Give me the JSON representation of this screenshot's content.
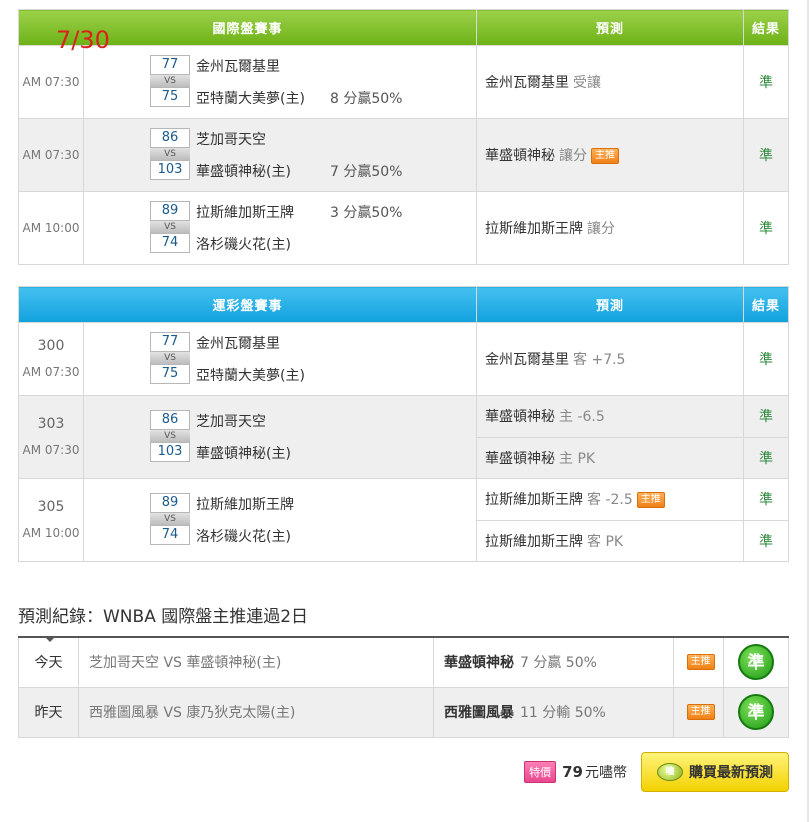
{
  "overlay_date": "7/30",
  "intl": {
    "headers": {
      "event": "國際盤賽事",
      "prediction": "預測",
      "result": "結果"
    },
    "games": [
      {
        "time": "AM 07:30",
        "score1": "77",
        "score2": "75",
        "team1": "金州瓦爾基里",
        "team2": "亞特蘭大美夢(主)",
        "handicap": "8 分贏50%",
        "handicap_row": 2,
        "pred_team": "金州瓦爾基里",
        "pred_note": "受讓",
        "main": false,
        "result": "準"
      },
      {
        "time": "AM 07:30",
        "score1": "86",
        "score2": "103",
        "team1": "芝加哥天空",
        "team2": "華盛頓神秘(主)",
        "handicap": "7 分贏50%",
        "handicap_row": 2,
        "pred_team": "華盛頓神秘",
        "pred_note": "讓分",
        "main": true,
        "result": "準"
      },
      {
        "time": "AM 10:00",
        "score1": "89",
        "score2": "74",
        "team1": "拉斯維加斯王牌",
        "team2": "洛杉磯火花(主)",
        "handicap": "3 分贏50%",
        "handicap_row": 1,
        "pred_team": "拉斯維加斯王牌",
        "pred_note": "讓分",
        "main": false,
        "result": "準"
      }
    ]
  },
  "sports": {
    "headers": {
      "event": "運彩盤賽事",
      "prediction": "預測",
      "result": "結果"
    },
    "games": [
      {
        "id": "300",
        "time": "AM 07:30",
        "score1": "77",
        "score2": "75",
        "team1": "金州瓦爾基里",
        "team2": "亞特蘭大美夢(主)",
        "preds": [
          {
            "team": "金州瓦爾基里",
            "note": "客 +7.5",
            "main": false,
            "result": "準"
          }
        ]
      },
      {
        "id": "303",
        "time": "AM 07:30",
        "score1": "86",
        "score2": "103",
        "team1": "芝加哥天空",
        "team2": "華盛頓神秘(主)",
        "preds": [
          {
            "team": "華盛頓神秘",
            "note": "主 -6.5",
            "main": false,
            "result": "準"
          },
          {
            "team": "華盛頓神秘",
            "note": "主 PK",
            "main": false,
            "result": "準"
          }
        ]
      },
      {
        "id": "305",
        "time": "AM 10:00",
        "score1": "89",
        "score2": "74",
        "team1": "拉斯維加斯王牌",
        "team2": "洛杉磯火花(主)",
        "preds": [
          {
            "team": "拉斯維加斯王牌",
            "note": "客 -2.5",
            "main": true,
            "result": "準"
          },
          {
            "team": "拉斯維加斯王牌",
            "note": "客 PK",
            "main": false,
            "result": "準"
          }
        ]
      }
    ]
  },
  "vs_label": "VS",
  "main_badge": "主推",
  "record": {
    "title": "預測紀錄：WNBA 國際盤主推連過2日",
    "rows": [
      {
        "day": "今天",
        "matchup": "芝加哥天空 VS 華盛頓神秘(主)",
        "pred_team": "華盛頓神秘",
        "pred_note": "7 分贏 50%",
        "badge": "主推",
        "result": "準"
      },
      {
        "day": "昨天",
        "matchup": "西雅圖風暴 VS 康乃狄克太陽(主)",
        "pred_team": "西雅圖風暴",
        "pred_note": "11 分輸 50%",
        "badge": "主推",
        "result": "準"
      }
    ]
  },
  "purchase": {
    "special_label": "特價",
    "price": "79",
    "currency": "元嚍幣",
    "button_label": "購買最新預測",
    "coin_text": "嚍"
  }
}
